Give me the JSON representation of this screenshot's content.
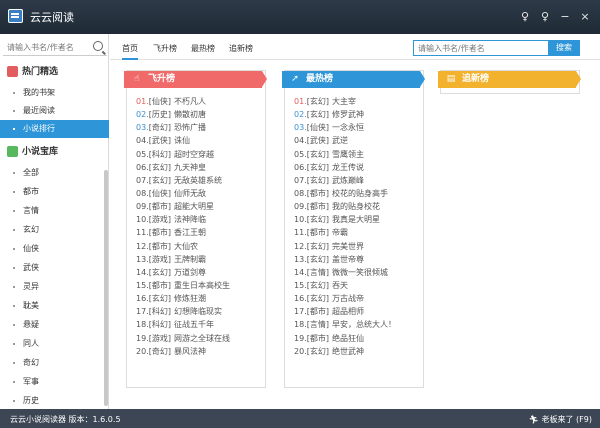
{
  "app": {
    "title": "云云阅读"
  },
  "sidebar": {
    "search_placeholder": "请输入书名/作者名",
    "section1": {
      "title": "热门精选",
      "color": "#e25d5d"
    },
    "section1_items": [
      "我的书架",
      "最近阅读",
      "小说排行"
    ],
    "active_item": "小说排行",
    "section2": {
      "title": "小说宝库",
      "color": "#58b85c"
    },
    "section2_items": [
      "全部",
      "都市",
      "言情",
      "玄幻",
      "仙侠",
      "武侠",
      "灵异",
      "耽美",
      "悬疑",
      "同人",
      "奇幻",
      "军事",
      "历史"
    ]
  },
  "tabs": [
    "首页",
    "飞升榜",
    "最热榜",
    "追新榜"
  ],
  "active_tab": "首页",
  "main_search": {
    "placeholder": "请输入书名/作者名",
    "button": "搜索"
  },
  "panels": [
    {
      "title": "飞升榜",
      "color": "#f06a6a",
      "icon": "hand-pointer-icon",
      "items": [
        {
          "rank": "01.",
          "cat": "[仙侠]",
          "title": "不朽凡人"
        },
        {
          "rank": "02.",
          "cat": "[历史]",
          "title": "懒散初唐"
        },
        {
          "rank": "03.",
          "cat": "[奇幻]",
          "title": "恐怖广播"
        },
        {
          "rank": "04.",
          "cat": "[武侠]",
          "title": "诛仙"
        },
        {
          "rank": "05.",
          "cat": "[科幻]",
          "title": "超时空穿越"
        },
        {
          "rank": "06.",
          "cat": "[玄幻]",
          "title": "九天神皇"
        },
        {
          "rank": "07.",
          "cat": "[玄幻]",
          "title": "无敌英雄系统"
        },
        {
          "rank": "08.",
          "cat": "[仙侠]",
          "title": "仙师无敌"
        },
        {
          "rank": "09.",
          "cat": "[都市]",
          "title": "超能大明星"
        },
        {
          "rank": "10.",
          "cat": "[游戏]",
          "title": "法神降临"
        },
        {
          "rank": "11.",
          "cat": "[都市]",
          "title": "香江王朝"
        },
        {
          "rank": "12.",
          "cat": "[都市]",
          "title": "大仙农"
        },
        {
          "rank": "13.",
          "cat": "[游戏]",
          "title": "王牌制霸"
        },
        {
          "rank": "14.",
          "cat": "[玄幻]",
          "title": "万道剑尊"
        },
        {
          "rank": "15.",
          "cat": "[都市]",
          "title": "重生日本高校生"
        },
        {
          "rank": "16.",
          "cat": "[玄幻]",
          "title": "修炼狂潮"
        },
        {
          "rank": "17.",
          "cat": "[科幻]",
          "title": "幻想降临现实"
        },
        {
          "rank": "18.",
          "cat": "[科幻]",
          "title": "征战五千年"
        },
        {
          "rank": "19.",
          "cat": "[游戏]",
          "title": "网游之全球在线"
        },
        {
          "rank": "20.",
          "cat": "[奇幻]",
          "title": "暴风法神"
        }
      ]
    },
    {
      "title": "最热榜",
      "color": "#2e96d8",
      "icon": "rocket-icon",
      "items": [
        {
          "rank": "01.",
          "cat": "[玄幻]",
          "title": "大主宰"
        },
        {
          "rank": "02.",
          "cat": "[玄幻]",
          "title": "修罗武神"
        },
        {
          "rank": "03.",
          "cat": "[仙侠]",
          "title": "一念永恒"
        },
        {
          "rank": "04.",
          "cat": "[武侠]",
          "title": "武逆"
        },
        {
          "rank": "05.",
          "cat": "[玄幻]",
          "title": "雪鹰领主"
        },
        {
          "rank": "06.",
          "cat": "[玄幻]",
          "title": "龙王传说"
        },
        {
          "rank": "07.",
          "cat": "[玄幻]",
          "title": "武炼巅峰"
        },
        {
          "rank": "08.",
          "cat": "[都市]",
          "title": "校花的贴身高手"
        },
        {
          "rank": "09.",
          "cat": "[都市]",
          "title": "我的贴身校花"
        },
        {
          "rank": "10.",
          "cat": "[玄幻]",
          "title": "我真是大明星"
        },
        {
          "rank": "11.",
          "cat": "[都市]",
          "title": "帝霸"
        },
        {
          "rank": "12.",
          "cat": "[玄幻]",
          "title": "完美世界"
        },
        {
          "rank": "13.",
          "cat": "[玄幻]",
          "title": "盖世帝尊"
        },
        {
          "rank": "14.",
          "cat": "[言情]",
          "title": "微微一笑很倾城"
        },
        {
          "rank": "15.",
          "cat": "[玄幻]",
          "title": "吞天"
        },
        {
          "rank": "16.",
          "cat": "[玄幻]",
          "title": "万古战帝"
        },
        {
          "rank": "17.",
          "cat": "[都市]",
          "title": "超品相师"
        },
        {
          "rank": "18.",
          "cat": "[言情]",
          "title": "早安，总统大人！"
        },
        {
          "rank": "19.",
          "cat": "[都市]",
          "title": "绝品狂仙"
        },
        {
          "rank": "20.",
          "cat": "[玄幻]",
          "title": "绝世武神"
        }
      ]
    },
    {
      "title": "追新榜",
      "color": "#f2b22e",
      "icon": "document-icon",
      "items": []
    }
  ],
  "status": {
    "left": "云云小说阅读器 版本：1.6.0.5",
    "right": "老板来了 (F9)"
  }
}
